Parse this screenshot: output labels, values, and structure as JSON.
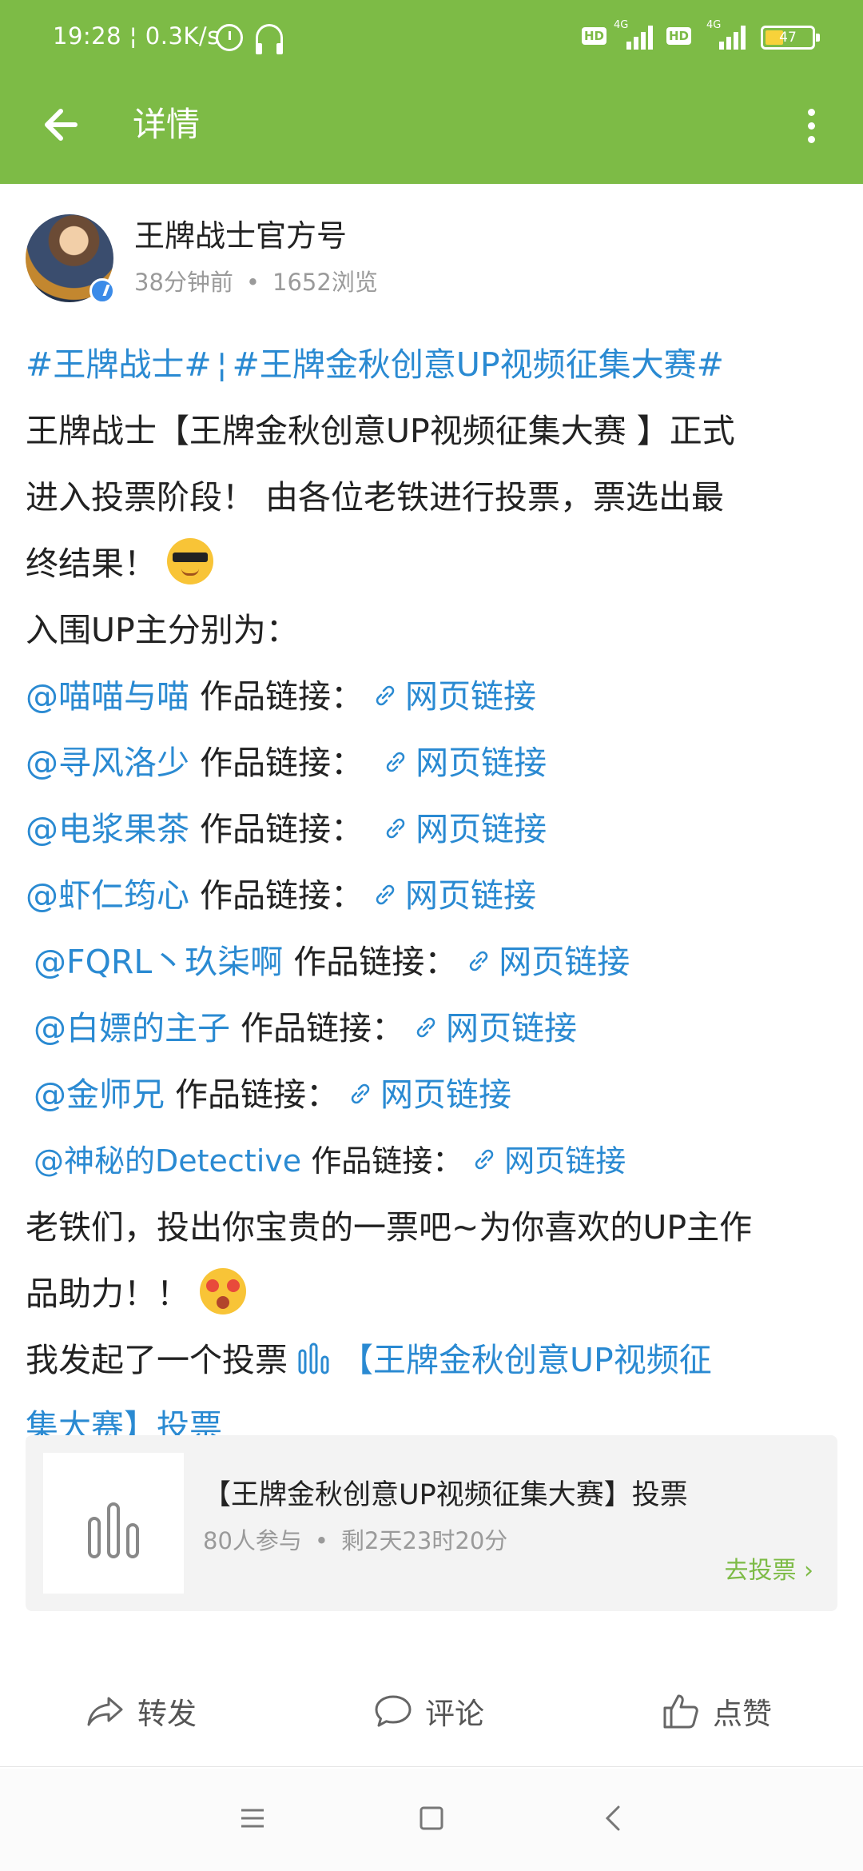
{
  "status_bar": {
    "time": "19:28",
    "network_speed": "0.3K/s",
    "sim1_hd": "HD",
    "sim1_type": "4G",
    "sim2_hd": "HD",
    "sim2_type": "4G",
    "battery": "47",
    "icons": [
      "alarm-clock-icon",
      "headset-icon",
      "signal-icon",
      "battery-icon"
    ]
  },
  "header": {
    "title": "详情",
    "back_icon": "arrow-left-icon",
    "more_icon": "more-vertical-icon",
    "color": "#7dbb46"
  },
  "post": {
    "author": "王牌战士官方号",
    "time_ago": "38分钟前",
    "separator": "•",
    "views": "1652浏览",
    "tags": [
      "#王牌战士#",
      "¦",
      "#王牌金秋创意UP视频征集大赛#"
    ],
    "intro_lines": [
      "王牌战士【王牌金秋创意UP视频征集大赛 】正式",
      "进入投票阶段！ 由各位老铁进行投票，票选出最",
      "终结果！"
    ],
    "list_title": "入围UP主分别为：",
    "link_label": "作品链接：",
    "link_text": "网页链接",
    "entries": [
      {
        "mention": "@喵喵与喵"
      },
      {
        "mention": "@寻风洛少"
      },
      {
        "mention": "@电浆果茶"
      },
      {
        "mention": "@虾仁筠心"
      },
      {
        "mention": "@FQRL丶玖柒啊"
      },
      {
        "mention": "@白嫖的主子"
      },
      {
        "mention": "@金师兄"
      },
      {
        "mention": "@神秘的Detective"
      }
    ],
    "closing_lines": [
      "老铁们，投出你宝贵的一票吧~为你喜欢的UP主作",
      "品助力！！"
    ],
    "vote_prefix": "我发起了一个投票",
    "vote_link_line1": "【王牌金秋创意UP视频征",
    "vote_link_line2": "集大赛】投票",
    "link_color": "#2a8ad2"
  },
  "vote_card": {
    "title": "【王牌金秋创意UP视频征集大赛】投票",
    "participants": "80人参与",
    "separator": "•",
    "remaining": "剩2天23时20分",
    "action": "去投票 ›"
  },
  "actions": {
    "share": "转发",
    "comment": "评论",
    "like": "点赞"
  }
}
